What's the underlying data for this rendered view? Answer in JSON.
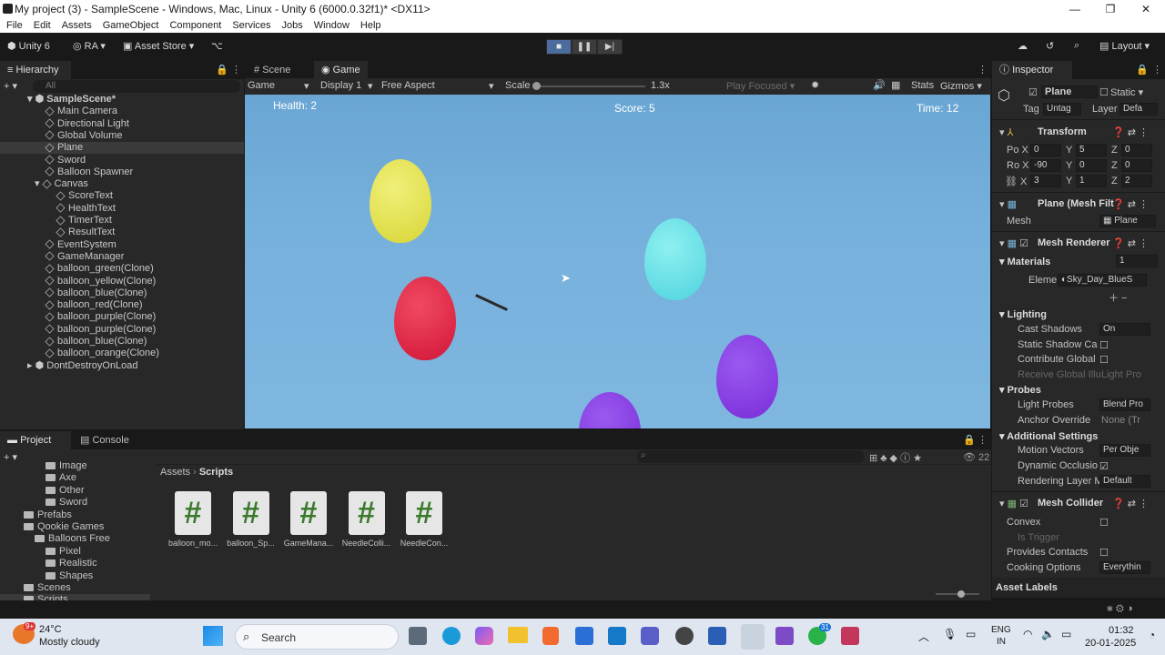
{
  "window": {
    "title": "My project (3) - SampleScene - Windows, Mac, Linux - Unity 6 (6000.0.32f1)* <DX11>",
    "minimize": "—",
    "maximize": "❐",
    "close": "✕"
  },
  "menu": [
    "File",
    "Edit",
    "Assets",
    "GameObject",
    "Component",
    "Services",
    "Jobs",
    "Window",
    "Help"
  ],
  "toolbar": {
    "unity_label": "Unity 6",
    "account": "RA",
    "asset_store": "Asset Store",
    "layout": "Layout"
  },
  "hierarchy": {
    "tab": "Hierarchy",
    "search_placeholder": "All",
    "scene": "SampleScene*",
    "items": [
      {
        "label": "Main Camera",
        "indent": 1
      },
      {
        "label": "Directional Light",
        "indent": 1
      },
      {
        "label": "Global Volume",
        "indent": 1
      },
      {
        "label": "Plane",
        "indent": 1,
        "selected": true
      },
      {
        "label": "Sword",
        "indent": 1
      },
      {
        "label": "Balloon Spawner",
        "indent": 1
      },
      {
        "label": "Canvas",
        "indent": 1,
        "expanded": true
      },
      {
        "label": "ScoreText",
        "indent": 2
      },
      {
        "label": "HealthText",
        "indent": 2
      },
      {
        "label": "TimerText",
        "indent": 2
      },
      {
        "label": "ResultText",
        "indent": 2
      },
      {
        "label": "EventSystem",
        "indent": 1
      },
      {
        "label": "GameManager",
        "indent": 1
      },
      {
        "label": "balloon_green(Clone)",
        "indent": 1
      },
      {
        "label": "balloon_yellow(Clone)",
        "indent": 1
      },
      {
        "label": "balloon_blue(Clone)",
        "indent": 1
      },
      {
        "label": "balloon_red(Clone)",
        "indent": 1
      },
      {
        "label": "balloon_purple(Clone)",
        "indent": 1
      },
      {
        "label": "balloon_purple(Clone)",
        "indent": 1
      },
      {
        "label": "balloon_blue(Clone)",
        "indent": 1
      },
      {
        "label": "balloon_orange(Clone)",
        "indent": 1
      }
    ],
    "dont_destroy": "DontDestroyOnLoad"
  },
  "scene_tabs": {
    "scene": "Scene",
    "game": "Game"
  },
  "game_toolbar": {
    "mode": "Game",
    "display": "Display 1",
    "aspect": "Free Aspect",
    "scale_label": "Scale",
    "scale_value": "1.3x",
    "play_focused": "Play Focused",
    "stats": "Stats",
    "gizmos": "Gizmos"
  },
  "game": {
    "health": "Health: 2",
    "score": "Score: 5",
    "time": "Time: 12"
  },
  "inspector": {
    "tab": "Inspector",
    "object_name": "Plane",
    "static_label": "Static",
    "tag_label": "Tag",
    "tag_value": "Untag",
    "layer_label": "Layer",
    "layer_value": "Defa",
    "transform": {
      "title": "Transform",
      "pos_label": "Po",
      "rot_label": "Ro",
      "pos": {
        "x": "0",
        "y": "5",
        "z": "0"
      },
      "rot": {
        "x": "-90",
        "y": "0",
        "z": "0"
      },
      "scale": {
        "x": "3",
        "y": "1",
        "z": "2"
      }
    },
    "mesh_filter": {
      "title": "Plane (Mesh Filt",
      "mesh_label": "Mesh",
      "mesh_value": "Plane"
    },
    "mesh_renderer": {
      "title": "Mesh Renderer",
      "materials_label": "Materials",
      "materials_count": "1",
      "element_label": "Eleme",
      "element_value": "Sky_Day_BlueS"
    },
    "lighting": {
      "title": "Lighting",
      "cast_shadows": "Cast Shadows",
      "cast_shadows_value": "On",
      "static_shadow": "Static Shadow Ca",
      "contribute_gi": "Contribute Global",
      "receive_gi": "Receive Global Illu",
      "receive_gi_value": "Light Pro"
    },
    "probes": {
      "title": "Probes",
      "light_probes": "Light Probes",
      "light_probes_value": "Blend Pro",
      "anchor_override": "Anchor Override",
      "anchor_value": "None (Tr"
    },
    "additional": {
      "title": "Additional Settings",
      "motion_vectors": "Motion Vectors",
      "motion_value": "Per Obje",
      "dynamic_occlusion": "Dynamic Occlusio",
      "rendering_layer": "Rendering Layer M",
      "rendering_value": "Default"
    },
    "mesh_collider": {
      "title": "Mesh Collider",
      "convex": "Convex",
      "is_trigger": "Is Trigger",
      "provides_contacts": "Provides Contacts",
      "cooking_options": "Cooking Options",
      "cooking_value": "Everythin"
    },
    "asset_labels": "Asset Labels"
  },
  "project": {
    "tab_project": "Project",
    "tab_console": "Console",
    "tree": [
      {
        "label": "Image",
        "indent": 3
      },
      {
        "label": "Axe",
        "indent": 3
      },
      {
        "label": "Other",
        "indent": 3
      },
      {
        "label": "Sword",
        "indent": 3
      },
      {
        "label": "Prefabs",
        "indent": 1
      },
      {
        "label": "Qookie Games",
        "indent": 1
      },
      {
        "label": "Balloons Free",
        "indent": 2
      },
      {
        "label": "Pixel",
        "indent": 3
      },
      {
        "label": "Realistic",
        "indent": 3
      },
      {
        "label": "Shapes",
        "indent": 3
      },
      {
        "label": "Scenes",
        "indent": 1
      },
      {
        "label": "Scripts",
        "indent": 1,
        "selected": true
      }
    ],
    "breadcrumb_root": "Assets",
    "breadcrumb_current": "Scripts",
    "hidden_count": "22",
    "scripts": [
      "balloon_mo...",
      "balloon_Sp...",
      "GameMana...",
      "NeedleColli...",
      "NeedleCon..."
    ]
  },
  "taskbar": {
    "temp": "24°C",
    "weather": "Mostly cloudy",
    "weather_badge": "9+",
    "search": "Search",
    "lang": "ENG",
    "region": "IN",
    "time": "01:32",
    "date": "20-01-2025",
    "whatsapp_badge": "31"
  }
}
